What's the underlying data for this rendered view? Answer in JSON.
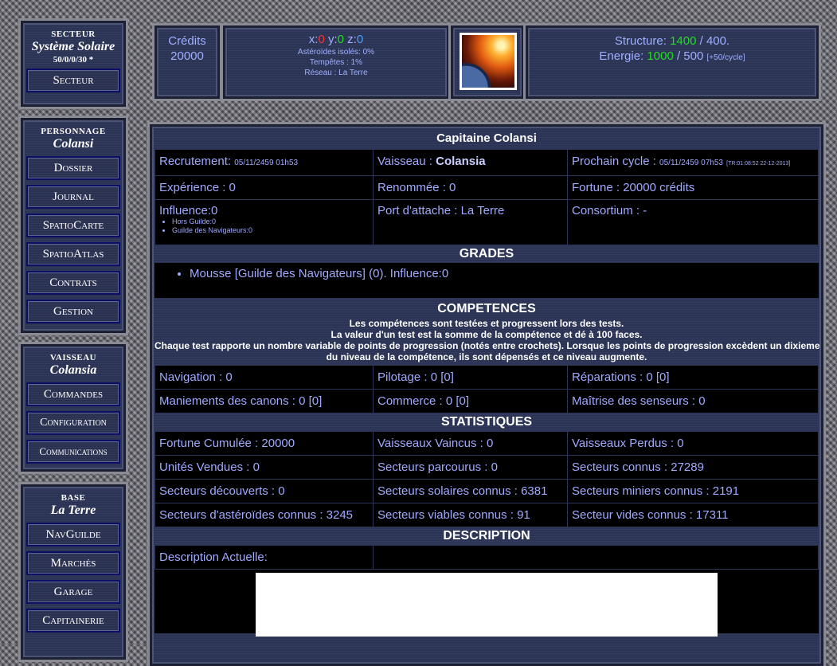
{
  "sidebar": {
    "sector": {
      "title": "SECTEUR",
      "name": "Système Solaire",
      "coords": "50/0/0/30 *",
      "buttons": [
        "Secteur"
      ]
    },
    "character": {
      "title": "PERSONNAGE",
      "name": "Colansi",
      "buttons": [
        "Dossier",
        "Journal",
        "SpatioCarte",
        "SpatioAtlas",
        "Contrats",
        "Gestion"
      ]
    },
    "ship": {
      "title": "VAISSEAU",
      "name": "Colansia",
      "buttons": [
        "Commandes",
        "Configuration",
        "Communications"
      ]
    },
    "base": {
      "title": "BASE",
      "name": "La Terre",
      "buttons": [
        "NavGuilde",
        "Marchés",
        "Garage",
        "Capitainerie"
      ]
    }
  },
  "header": {
    "credits_label": "Crédits",
    "credits_value": "20000",
    "x_label": "x:",
    "x_value": "0",
    "y_label": "y:",
    "y_value": "0",
    "z_label": "z:",
    "z_value": "0",
    "asteroids": "Astéroïdes isolés: 0%",
    "storms": "Tempêtes : 1%",
    "network": "Réseau : La Terre",
    "structure_label": "Structure:",
    "structure_value": "1400",
    "structure_max": "/ 400.",
    "energy_label": "Energie:",
    "energy_value": "1000",
    "energy_max": "/ 500",
    "energy_rate": "[+50/cycle]"
  },
  "main": {
    "title": "Capitaine Colansi",
    "info": {
      "recruit_label": "Recrutement: ",
      "recruit_value": "05/11/2459 01h53",
      "ship_label": "Vaisseau : ",
      "ship_value": "Colansia",
      "next_label": "Prochain cycle : ",
      "next_value": "05/11/2459 07h53",
      "next_tr": "[TR:01:08:52 22-12-2013]",
      "experience": "Expérience : 0",
      "renown": "Renommée : 0",
      "fortune": "Fortune : 20000 crédits",
      "influence": "Influence:0",
      "influence_items": [
        "Hors Guilde:0",
        "Guilde des Navigateurs:0"
      ],
      "home_port": "Port d'attache : La Terre",
      "consortium": "Consortium : -"
    },
    "grades": {
      "title": "GRADES",
      "items": [
        "Mousse [Guilde des Navigateurs] (0). Influence:0"
      ]
    },
    "competences": {
      "title": "COMPETENCES",
      "desc": [
        "Les compétences sont testées et progressent lors des tests.",
        "La valeur d'un test est la somme de la compétence et dé à 100 faces.",
        "Chaque test rapporte un nombre variable de points de progression (notés entre crochets). Lorsque les points de progression excèdent un dixieme",
        "du niveau de la compétence, ils sont dépensés et ce niveau augmente."
      ],
      "rows": [
        [
          "Navigation : 0",
          "Pilotage : 0 [0]",
          "Réparations : 0 [0]"
        ],
        [
          "Maniements des canons : 0 [0]",
          "Commerce : 0 [0]",
          "Maîtrise des senseurs : 0"
        ]
      ]
    },
    "stats": {
      "title": "STATISTIQUES",
      "rows": [
        [
          "Fortune Cumulée : 20000",
          "Vaisseaux Vaincus : 0",
          "Vaisseaux Perdus : 0"
        ],
        [
          "Unités Vendues : 0",
          "Secteurs parcourus : 0",
          "Secteurs connus : 27289"
        ],
        [
          "Secteurs découverts : 0",
          "Secteurs solaires connus : 6381",
          "Secteurs miniers connus : 2191"
        ],
        [
          "Secteurs d'astéroïdes connus : 3245",
          "Secteurs viables connus : 91",
          "Secteur vides connus : 17311"
        ]
      ]
    },
    "description": {
      "title": "DESCRIPTION",
      "current_label": "Description Actuelle:",
      "current_value": ""
    }
  }
}
